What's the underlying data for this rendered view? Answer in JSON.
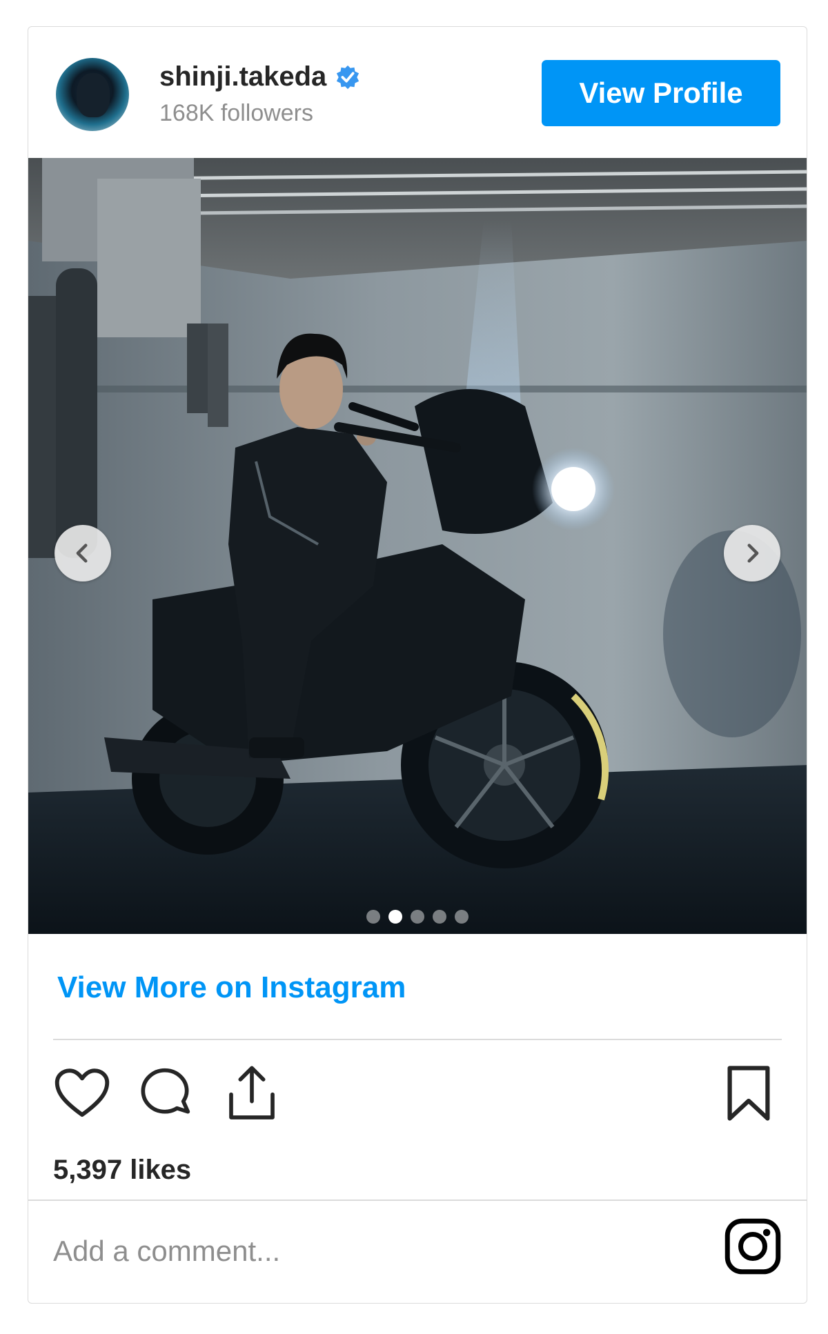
{
  "profile": {
    "username": "shinji.takeda",
    "followers": "168K followers",
    "view_profile_label": "View Profile"
  },
  "carousel": {
    "slide_count": 5,
    "active_index": 1
  },
  "view_more_label": "View More on Instagram",
  "likes": "5,397 likes",
  "comment": {
    "placeholder": "Add a comment...",
    "value": ""
  },
  "colors": {
    "accent": "#0095f6",
    "text": "#262626",
    "muted": "#8e8e8e",
    "border": "#dbdbdb"
  },
  "icons": {
    "verified": "verified-badge-icon",
    "like": "heart-icon",
    "comment": "comment-icon",
    "share": "share-icon",
    "save": "bookmark-icon",
    "brand": "instagram-icon",
    "prev": "chevron-left-icon",
    "next": "chevron-right-icon"
  }
}
